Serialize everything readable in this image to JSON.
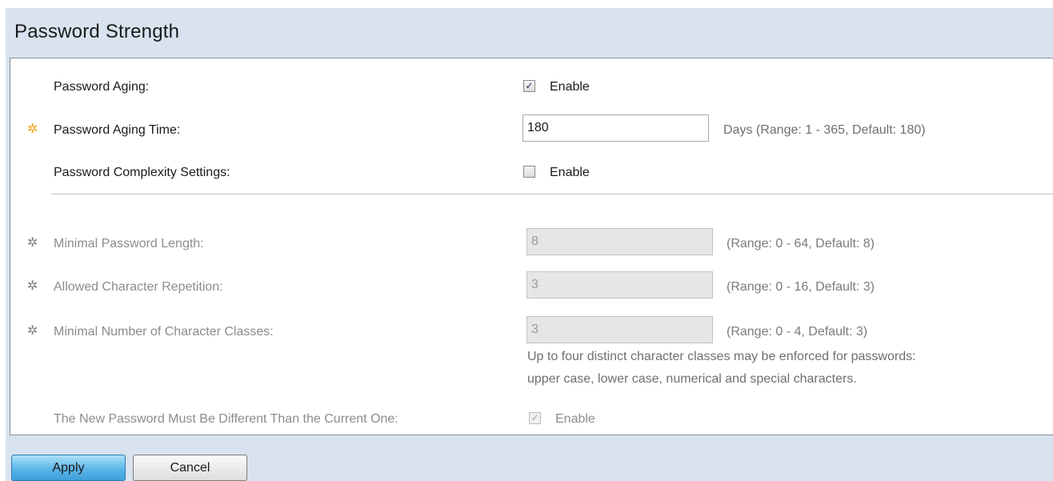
{
  "title": "Password Strength",
  "password_aging": {
    "label": "Password Aging:",
    "checked": true,
    "checkbox_label": "Enable"
  },
  "password_aging_time": {
    "label": "Password Aging Time:",
    "value": "180",
    "hint": "Days (Range: 1 - 365, Default: 180)"
  },
  "complexity": {
    "label": "Password Complexity Settings:",
    "checked": false,
    "checkbox_label": "Enable"
  },
  "min_length": {
    "label": "Minimal Password Length:",
    "value": "8",
    "hint": "(Range: 0 - 64, Default: 8)"
  },
  "char_repetition": {
    "label": "Allowed Character Repetition:",
    "value": "3",
    "hint": "(Range: 0 - 16, Default: 3)"
  },
  "char_classes": {
    "label": "Minimal Number of Character Classes:",
    "value": "3",
    "hint": "(Range: 0 - 4, Default: 3)",
    "desc_line1": "Up to four distinct character classes may be enforced for passwords:",
    "desc_line2": "upper case, lower case, numerical and special characters."
  },
  "must_differ": {
    "label": "The New Password Must Be Different Than the Current One:",
    "checked": true,
    "checkbox_label": "Enable"
  },
  "buttons": {
    "apply": "Apply",
    "cancel": "Cancel"
  },
  "colors": {
    "required_icon": "#f2a20c",
    "disabled_icon": "#7f7f7f",
    "apply_button": "#5cb5e8"
  }
}
